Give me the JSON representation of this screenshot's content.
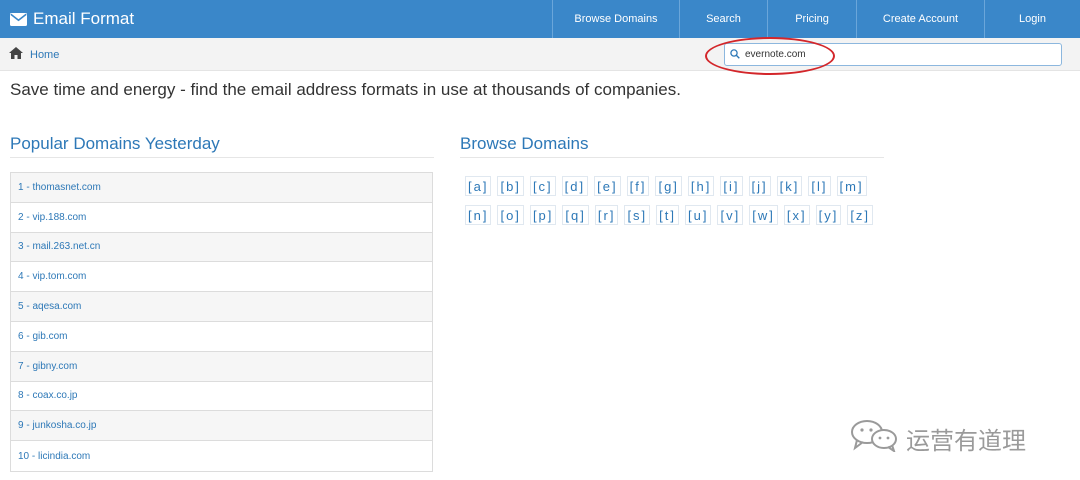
{
  "navbar": {
    "brand": "Email Format",
    "brand_icon": "envelope-icon",
    "links": [
      "Browse Domains",
      "Search",
      "Pricing",
      "Create Account",
      "Login"
    ],
    "background": "#3a87c9"
  },
  "breadcrumb": {
    "home_label": "Home",
    "home_icon": "home-icon"
  },
  "search": {
    "value": "evernote.com",
    "icon": "search-icon"
  },
  "tagline": "Save time and energy - find the email address formats in use at thousands of companies.",
  "popular": {
    "title": "Popular Domains Yesterday",
    "items": [
      "1 - thomasnet.com",
      "2 - vip.188.com",
      "3 - mail.263.net.cn",
      "4 - vip.tom.com",
      "5 - aqesa.com",
      "6 - gib.com",
      "7 - gibny.com",
      "8 - coax.co.jp",
      "9 - junkosha.co.jp",
      "10 - licindia.com"
    ]
  },
  "browse": {
    "title": "Browse Domains",
    "letters": [
      "[a]",
      "[b]",
      "[c]",
      "[d]",
      "[e]",
      "[f]",
      "[g]",
      "[h]",
      "[i]",
      "[j]",
      "[k]",
      "[l]",
      "[m]",
      "[n]",
      "[o]",
      "[p]",
      "[q]",
      "[r]",
      "[s]",
      "[t]",
      "[u]",
      "[v]",
      "[w]",
      "[x]",
      "[y]",
      "[z]"
    ]
  },
  "watermark": {
    "text": "运营有道理",
    "icon": "wechat-icon"
  },
  "colors": {
    "link": "#2d78b7",
    "annotation": "#d3262a"
  }
}
